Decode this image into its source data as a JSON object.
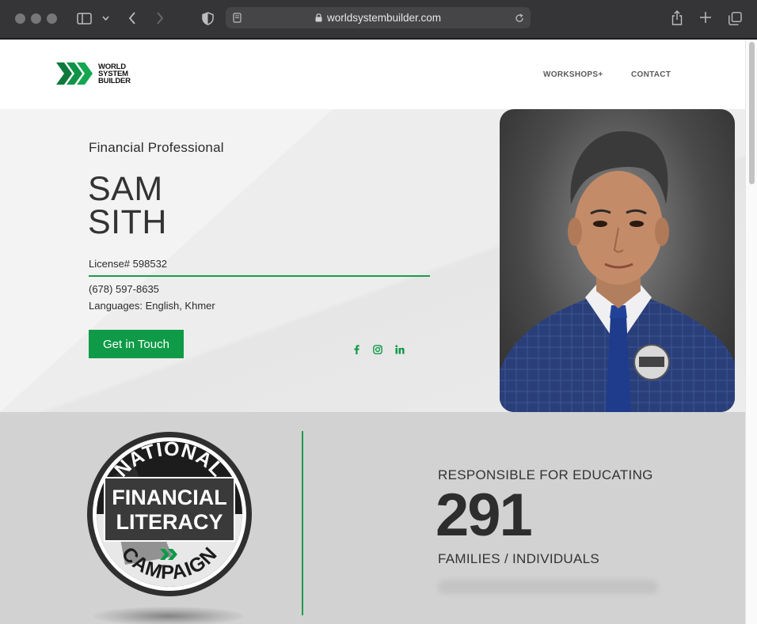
{
  "browser": {
    "url": "worldsystembuilder.com"
  },
  "header": {
    "logo_lines": [
      "WORLD",
      "SYSTEM",
      "BUILDER"
    ],
    "nav": [
      {
        "label": "WORKSHOPS+"
      },
      {
        "label": "CONTACT"
      }
    ]
  },
  "hero": {
    "role": "Financial Professional",
    "name_first": "SAM",
    "name_last": "SITH",
    "license": "License# 598532",
    "phone": "(678) 597-8635",
    "languages": "Languages: English, Khmer",
    "cta_label": "Get in Touch",
    "social": [
      "facebook-icon",
      "instagram-icon",
      "linkedin-icon"
    ]
  },
  "badge": {
    "top": "NATIONAL",
    "middle1": "FINANCIAL",
    "middle2": "LITERACY",
    "bottom": "CAMPAIGN"
  },
  "stats": {
    "top_label": "RESPONSIBLE FOR EDUCATING",
    "count": "291",
    "bottom_label": "FAMILIES / INDIVIDUALS"
  },
  "colors": {
    "brand_green": "#0e9a47",
    "chrome_bg": "#353537",
    "band_bg": "#d2d2d2"
  }
}
